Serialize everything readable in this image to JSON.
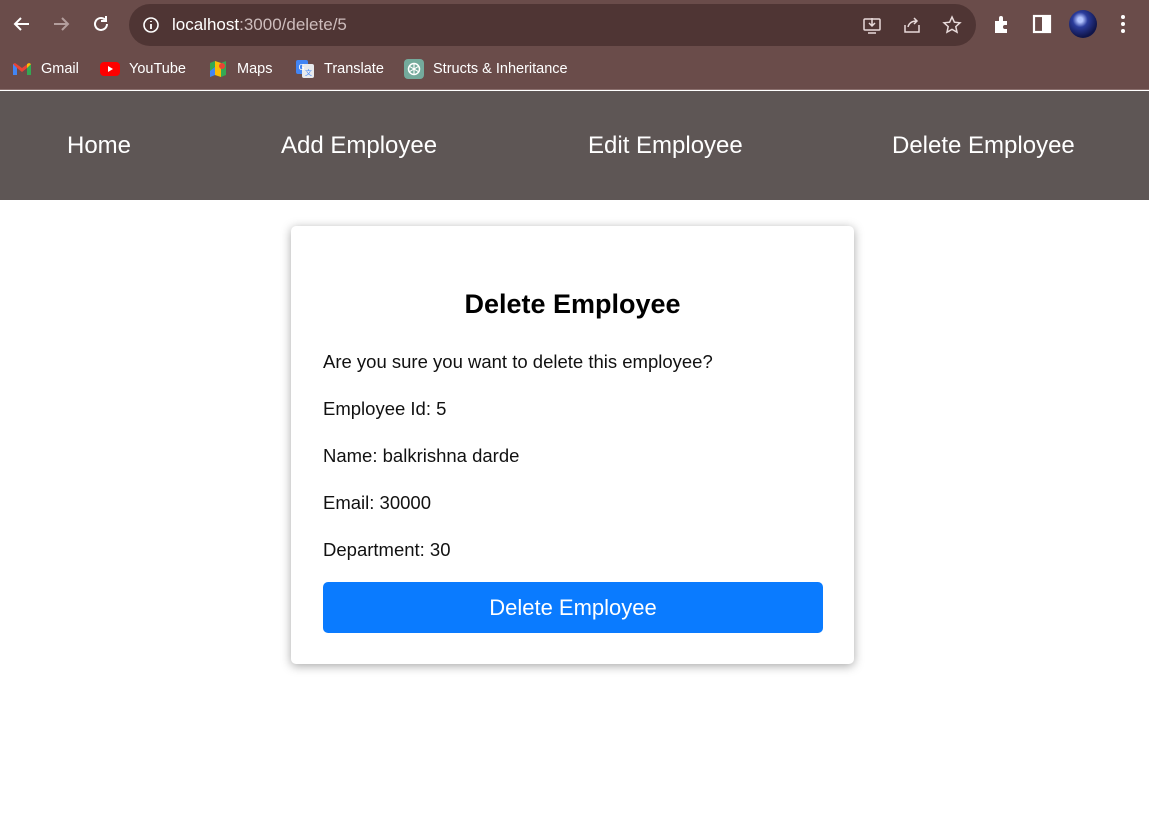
{
  "browser": {
    "url_host": "localhost",
    "url_path": ":3000/delete/5",
    "bookmarks": [
      {
        "label": "Gmail",
        "icon": "gmail-icon"
      },
      {
        "label": "YouTube",
        "icon": "youtube-icon"
      },
      {
        "label": "Maps",
        "icon": "maps-icon"
      },
      {
        "label": "Translate",
        "icon": "translate-icon"
      },
      {
        "label": "Structs & Inheritance",
        "icon": "chatgpt-icon"
      }
    ]
  },
  "nav": {
    "home": "Home",
    "add": "Add Employee",
    "edit": "Edit Employee",
    "delete": "Delete Employee"
  },
  "card": {
    "title": "Delete Employee",
    "question": "Are you sure you want to delete this employee?",
    "id_line": "Employee Id: 5",
    "name_line": "Name: balkrishna darde",
    "email_line": "Email: 30000",
    "department_line": "Department: 30",
    "button_label": "Delete Employee"
  },
  "colors": {
    "browser_frame": "#6a4c4a",
    "nav_bar": "#5e5655",
    "button": "#0a7bff"
  }
}
